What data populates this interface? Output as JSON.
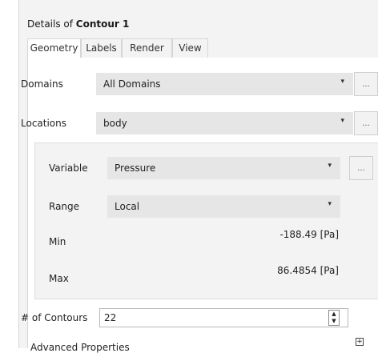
{
  "header": {
    "title_prefix": "Details of ",
    "title_bold": "Contour 1"
  },
  "tabs": [
    {
      "label": "Geometry",
      "active": true
    },
    {
      "label": "Labels"
    },
    {
      "label": "Render"
    },
    {
      "label": "View"
    }
  ],
  "geometry": {
    "domains": {
      "label": "Domains",
      "value": "All Domains",
      "button": "..."
    },
    "locations": {
      "label": "Locations",
      "value": "body",
      "button": "..."
    },
    "variable": {
      "label": "Variable",
      "value": "Pressure",
      "button": "..."
    },
    "range": {
      "label": "Range",
      "value": "Local"
    },
    "min": {
      "label": "Min",
      "value": "-188.49 [Pa]"
    },
    "max": {
      "label": "Max",
      "value": "86.4854 [Pa]"
    },
    "contours": {
      "label": "# of Contours",
      "value": "22"
    },
    "advanced": {
      "label": "Advanced Properties"
    }
  },
  "icons": {
    "dropdown": "▾",
    "spin_up": "▲",
    "spin_down": "▼",
    "expand": "+"
  }
}
